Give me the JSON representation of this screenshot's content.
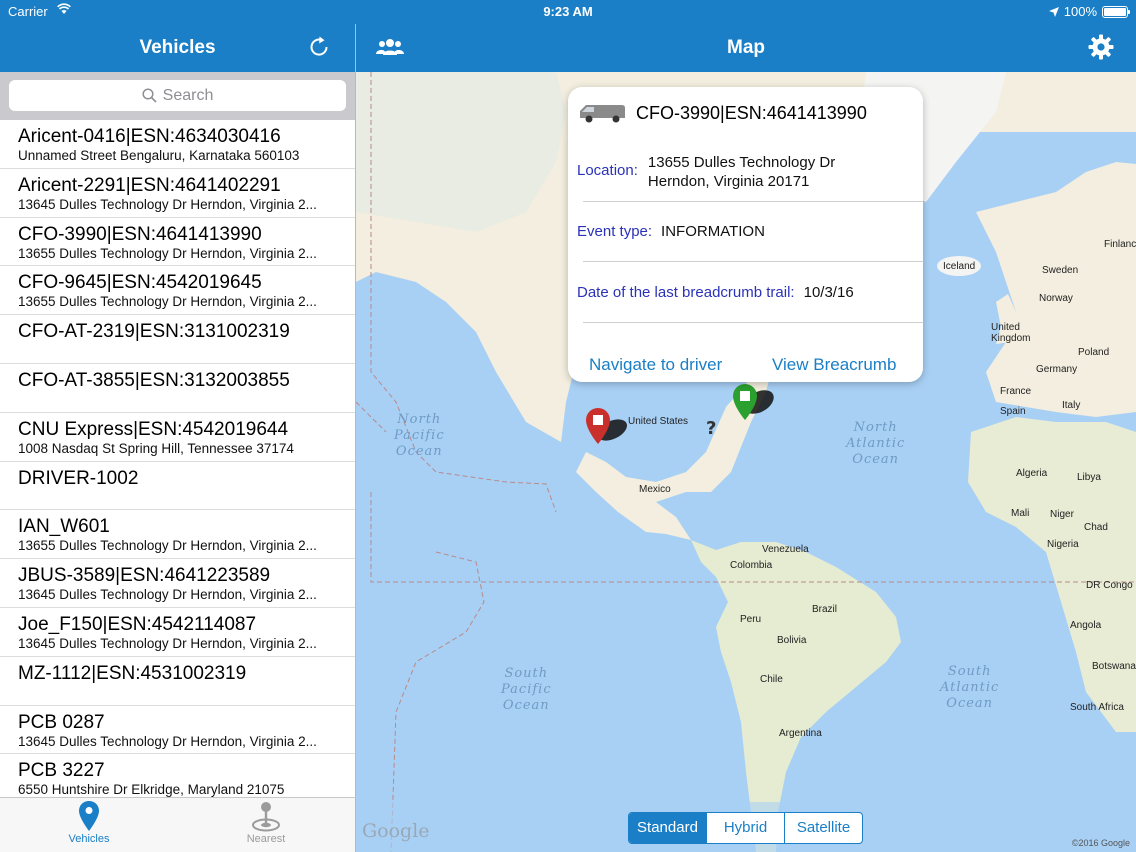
{
  "status_bar": {
    "carrier": "Carrier",
    "time": "9:23 AM",
    "battery": "100%",
    "battery_level": 1.0
  },
  "vehicles_panel": {
    "title": "Vehicles",
    "search_placeholder": "Search",
    "items": [
      {
        "name": "Aricent-0416|ESN:4634030416",
        "address": "Unnamed Street  Bengaluru, Karnataka 560103"
      },
      {
        "name": "Aricent-2291|ESN:4641402291",
        "address": "13645 Dulles Technology Dr  Herndon, Virginia 2..."
      },
      {
        "name": "CFO-3990|ESN:4641413990",
        "address": "13655 Dulles Technology Dr  Herndon, Virginia 2..."
      },
      {
        "name": "CFO-9645|ESN:4542019645",
        "address": "13655 Dulles Technology Dr  Herndon, Virginia 2..."
      },
      {
        "name": "CFO-AT-2319|ESN:3131002319",
        "address": ""
      },
      {
        "name": "CFO-AT-3855|ESN:3132003855",
        "address": ""
      },
      {
        "name": "CNU Express|ESN:4542019644",
        "address": "1008 Nasdaq St  Spring Hill, Tennessee 37174"
      },
      {
        "name": "DRIVER-1002",
        "address": ""
      },
      {
        "name": "IAN_W601",
        "address": "13655 Dulles Technology Dr  Herndon, Virginia 2..."
      },
      {
        "name": "JBUS-3589|ESN:4641223589",
        "address": "13645 Dulles Technology Dr  Herndon, Virginia 2..."
      },
      {
        "name": "Joe_F150|ESN:4542114087",
        "address": "13645 Dulles Technology Dr  Herndon, Virginia 2..."
      },
      {
        "name": "MZ-1112|ESN:4531002319",
        "address": ""
      },
      {
        "name": "PCB 0287",
        "address": "13645 Dulles Technology Dr  Herndon, Virginia 2..."
      },
      {
        "name": "PCB 3227",
        "address": "6550 Huntshire Dr  Elkridge, Maryland 21075"
      }
    ],
    "tabs": [
      {
        "label": "Vehicles",
        "icon": "map-pin-icon",
        "active": true
      },
      {
        "label": "Nearest",
        "icon": "nearest-icon",
        "active": false
      }
    ]
  },
  "map_panel": {
    "title": "Map",
    "popup": {
      "vehicle": "CFO-3990|ESN:4641413990",
      "location_label": "Location:",
      "location_line1": "13655 Dulles Technology Dr",
      "location_line2": "Herndon, Virginia 20171",
      "event_label": "Event type:",
      "event_value": "INFORMATION",
      "breadcrumb_label": "Date of the last breadcrumb trail:",
      "breadcrumb_value": "10/3/16",
      "navigate_button": "Navigate to driver",
      "breadcrumb_button": "View Breacrumb"
    },
    "map_types": [
      "Standard",
      "Hybrid",
      "Satellite"
    ],
    "active_map_type": "Standard",
    "google_logo": "Google",
    "copyright": "©2016 Google",
    "oceans": {
      "north_pacific": [
        "North",
        "Pacific",
        "Ocean"
      ],
      "north_atlantic": [
        "North",
        "Atlantic",
        "Ocean"
      ],
      "south_pacific": [
        "South",
        "Pacific",
        "Ocean"
      ],
      "south_atlantic": [
        "South",
        "Atlantic",
        "Ocean"
      ]
    },
    "places": {
      "iceland": "Iceland",
      "sweden": "Sweden",
      "norway": "Norway",
      "finland": "Finlanc",
      "uk": [
        "United",
        "Kingdom"
      ],
      "poland": "Poland",
      "germany": "Germany",
      "france": "France",
      "italy": "Italy",
      "spain": "Spain",
      "us": "United States",
      "mexico": "Mexico",
      "algeria": "Algeria",
      "libya": "Libya",
      "mali": "Mali",
      "niger": "Niger",
      "chad": "Chad",
      "nigeria": "Nigeria",
      "drc": "DR Congo",
      "angola": "Angola",
      "botswana": "Botswana",
      "south_africa": "South Africa",
      "venezuela": "Venezuela",
      "colombia": "Colombia",
      "brazil": "Brazil",
      "peru": "Peru",
      "bolivia": "Bolivia",
      "chile": "Chile",
      "argentina": "Argentina"
    }
  },
  "colors": {
    "nav_blue": "#1a7fc6",
    "ocean": "#a8d0f5",
    "land": "#f3eedf",
    "label_blue": "#2a32b8"
  }
}
